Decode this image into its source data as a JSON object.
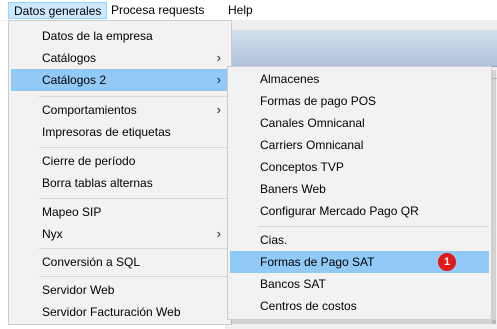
{
  "menubar": {
    "items": [
      {
        "label": "Datos generales"
      },
      {
        "label": "Procesa requests"
      },
      {
        "label": "Help"
      }
    ]
  },
  "menu": {
    "items": [
      {
        "label": "Datos de la empresa"
      },
      {
        "label": "Catálogos",
        "arrow": "›"
      },
      {
        "label": "Catálogos 2",
        "arrow": "›"
      },
      {
        "label": "Comportamientos",
        "arrow": "›"
      },
      {
        "label": "Impresoras de etiquetas"
      },
      {
        "label": "Cierre de período"
      },
      {
        "label": "Borra tablas alternas"
      },
      {
        "label": "Mapeo SIP"
      },
      {
        "label": "Nyx",
        "arrow": "›"
      },
      {
        "label": "Conversión a SQL"
      },
      {
        "label": "Servidor Web"
      },
      {
        "label": "Servidor Facturación Web"
      }
    ]
  },
  "submenu": {
    "items": [
      {
        "label": "Almacenes"
      },
      {
        "label": "Formas de pago POS"
      },
      {
        "label": "Canales Omnicanal"
      },
      {
        "label": "Carriers Omnicanal"
      },
      {
        "label": "Conceptos TVP"
      },
      {
        "label": "Baners Web"
      },
      {
        "label": "Configurar Mercado Pago QR"
      },
      {
        "label": "Cias."
      },
      {
        "label": "Formas de Pago SAT"
      },
      {
        "label": "Bancos SAT"
      },
      {
        "label": "Centros de costos"
      }
    ],
    "badge": "1"
  },
  "colors": {
    "highlight": "#91c9f7",
    "badge": "#e11a1a",
    "menubar_active": "#cce8ff"
  }
}
